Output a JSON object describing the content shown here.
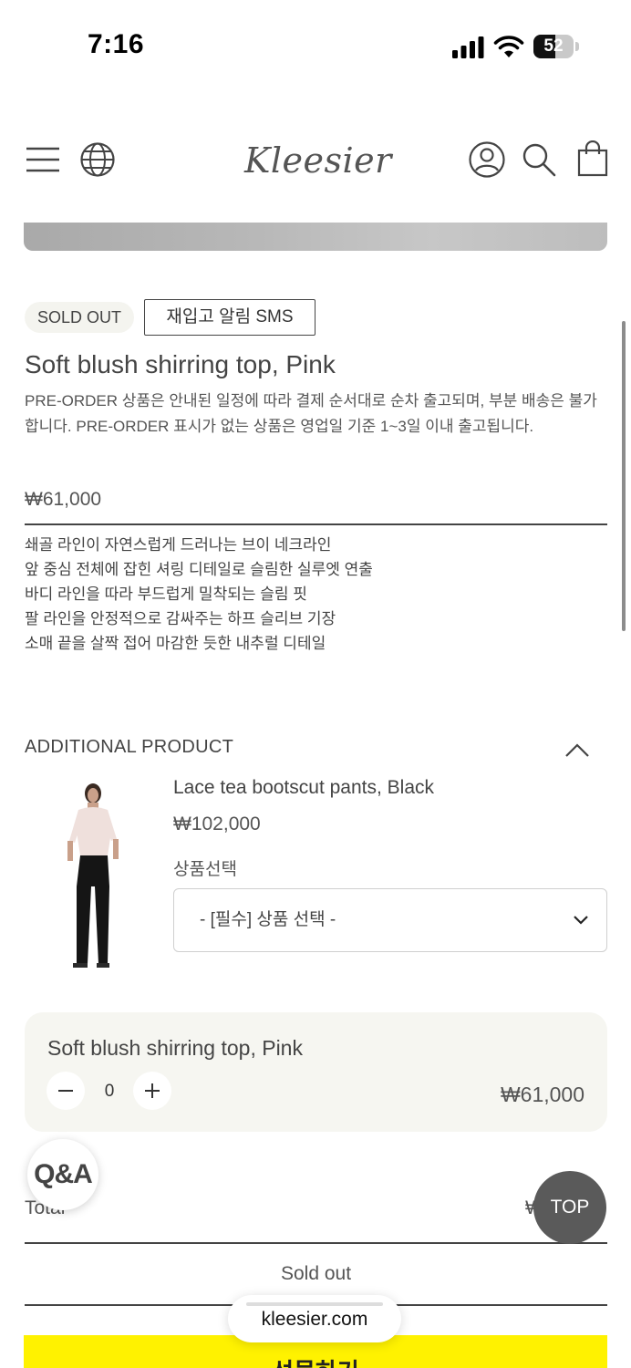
{
  "status_bar": {
    "time": "7:16",
    "battery": "52"
  },
  "header": {
    "logo": "Kleesier"
  },
  "product": {
    "badge": "SOLD OUT",
    "restock_button": "재입고 알림 SMS",
    "title": "Soft blush shirring top, Pink",
    "notice": "PRE-ORDER 상품은 안내된 일정에 따라 결제 순서대로 순차 출고되며, 부분 배송은 불가합니다. PRE-ORDER 표시가 없는 상품은 영업일 기준 1~3일 이내 출고됩니다.",
    "price": "₩61,000",
    "description": [
      "쇄골 라인이 자연스럽게 드러나는 브이 네크라인",
      "앞 중심 전체에 잡힌 셔링 디테일로 슬림한 실루엣 연출",
      "바디 라인을 따라 부드럽게 밀착되는 슬림 핏",
      "팔 라인을 안정적으로 감싸주는 하프 슬리브 기장",
      "소매 끝을 살짝 접어 마감한 듯한 내추럴 디테일"
    ]
  },
  "additional": {
    "heading": "ADDITIONAL PRODUCT",
    "item": {
      "name": "Lace tea bootscut pants, Black",
      "price": "₩102,000",
      "option_label": "상품선택",
      "option_value": "- [필수] 상품 선택 -"
    }
  },
  "selected": {
    "name": "Soft blush shirring top, Pink",
    "quantity": "0",
    "price": "₩61,000"
  },
  "total": {
    "label": "Total",
    "value": "₩"
  },
  "sold_out_label": "Sold out",
  "buy_button": "선물하기",
  "floating": {
    "qa": "Q&A",
    "top": "TOP"
  },
  "browser": {
    "url": "kleesier.com"
  }
}
